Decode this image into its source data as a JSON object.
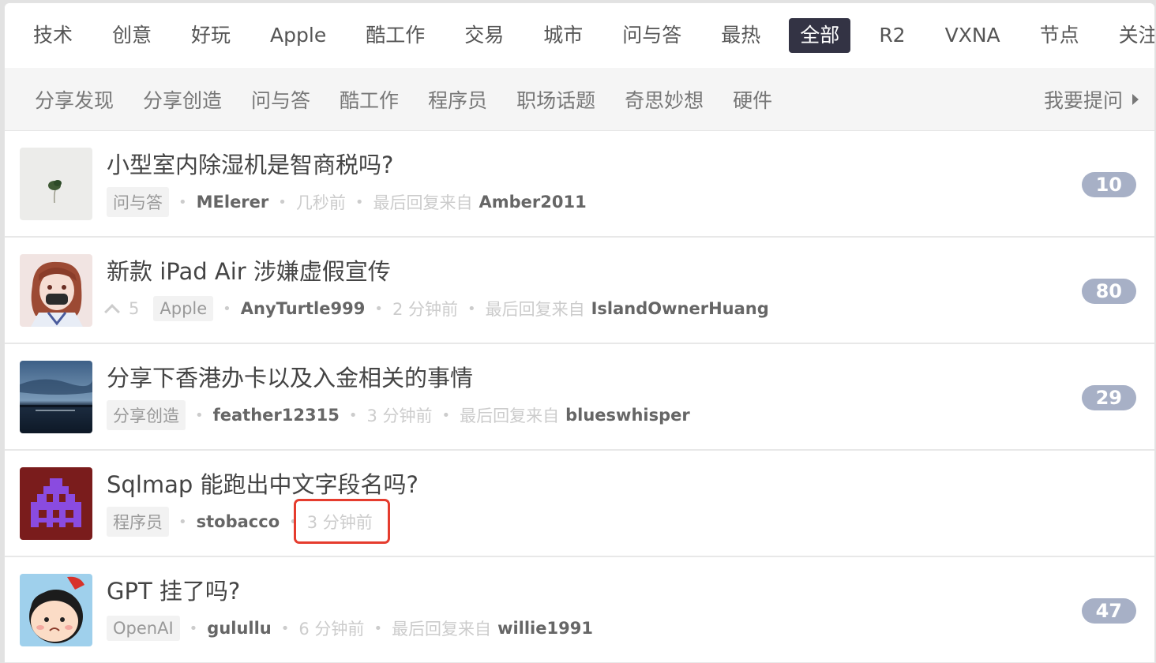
{
  "tabs": [
    "技术",
    "创意",
    "好玩",
    "Apple",
    "酷工作",
    "交易",
    "城市",
    "问与答",
    "最热",
    "全部",
    "R2",
    "VXNA",
    "节点",
    "关注"
  ],
  "active_tab": "全部",
  "subnav": {
    "items": [
      "分享发现",
      "分享创造",
      "问与答",
      "酷工作",
      "程序员",
      "职场话题",
      "奇思妙想",
      "硬件"
    ],
    "ask_label": "我要提问"
  },
  "topics": [
    {
      "title": "小型室内除湿机是智商税吗?",
      "node": "问与答",
      "author": "MElerer",
      "time": "几秒前",
      "last_reply_label": "最后回复来自",
      "last_reply_user": "Amber2011",
      "replies": "10",
      "votes": ""
    },
    {
      "title": "新款 iPad Air 涉嫌虚假宣传",
      "node": "Apple",
      "author": "AnyTurtle999",
      "time": "2 分钟前",
      "last_reply_label": "最后回复来自",
      "last_reply_user": "IslandOwnerHuang",
      "replies": "80",
      "votes": "5"
    },
    {
      "title": "分享下香港办卡以及入金相关的事情",
      "node": "分享创造",
      "author": "feather12315",
      "time": "3 分钟前",
      "last_reply_label": "最后回复来自",
      "last_reply_user": "blueswhisper",
      "replies": "29",
      "votes": ""
    },
    {
      "title": "Sqlmap 能跑出中文字段名吗?",
      "node": "程序员",
      "author": "stobacco",
      "time": "3 分钟前",
      "last_reply_label": "",
      "last_reply_user": "",
      "replies": "",
      "votes": ""
    },
    {
      "title": "GPT 挂了吗?",
      "node": "OpenAI",
      "author": "gulullu",
      "time": "6 分钟前",
      "last_reply_label": "最后回复来自",
      "last_reply_user": "willie1991",
      "replies": "47",
      "votes": ""
    }
  ],
  "colors": {
    "active_tab_bg": "#333344",
    "count_bg": "#a7b0c6",
    "highlight": "#e53c2e"
  }
}
